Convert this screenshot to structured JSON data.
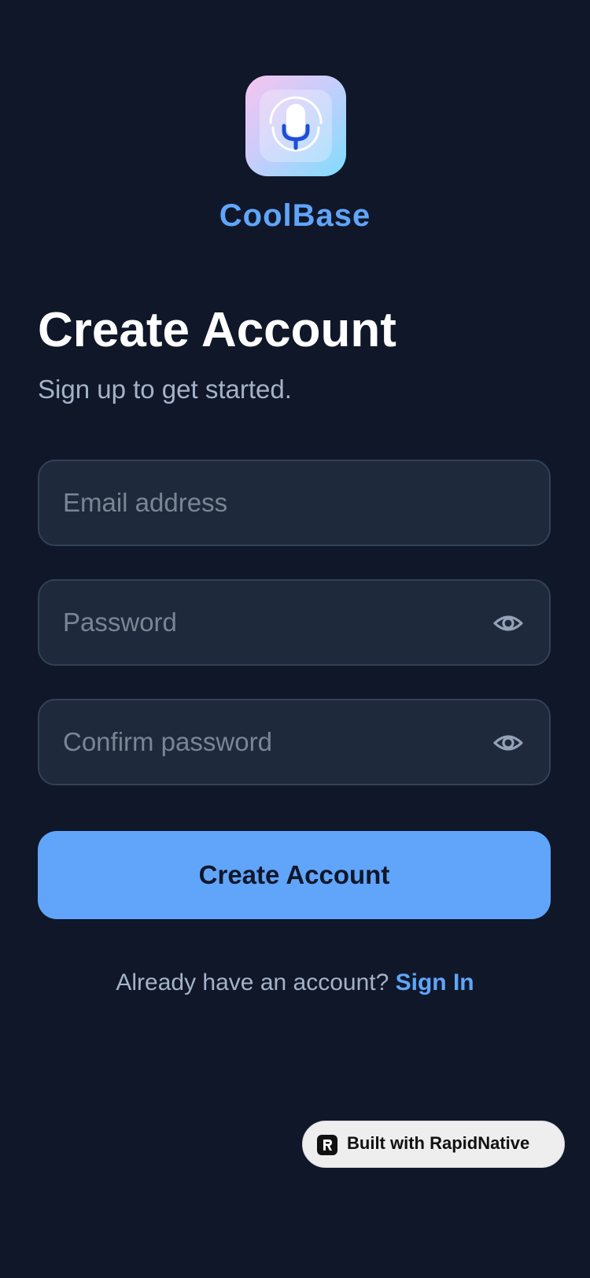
{
  "app": {
    "name": "CoolBase",
    "logo_icon": "microphone-icon"
  },
  "header": {
    "title": "Create Account",
    "subtitle": "Sign up to get started."
  },
  "form": {
    "email": {
      "placeholder": "Email address",
      "value": ""
    },
    "password": {
      "placeholder": "Password",
      "value": "",
      "toggle_icon": "eye-icon"
    },
    "confirm_password": {
      "placeholder": "Confirm password",
      "value": "",
      "toggle_icon": "eye-icon"
    },
    "submit_label": "Create Account"
  },
  "footer": {
    "prompt": "Already have an account?",
    "link_label": "Sign In"
  },
  "badge": {
    "label": "Built with RapidNative",
    "icon": "rapidnative-logo-icon"
  },
  "colors": {
    "background": "#0f1729",
    "accent": "#60a5fa",
    "field_bg": "#1e293b",
    "field_border": "#334155",
    "muted_text": "#a5b3c9"
  }
}
